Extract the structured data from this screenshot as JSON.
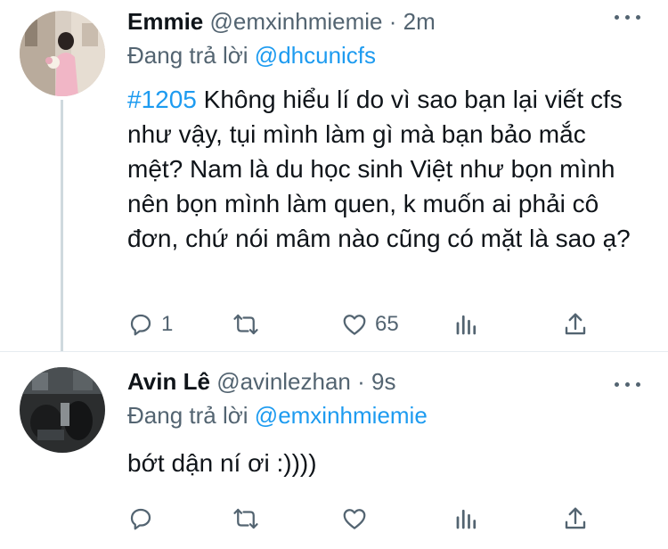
{
  "tweets": [
    {
      "name": "Emmie",
      "handle": "@emxinhmiemie",
      "separator": "·",
      "time": "2m",
      "replying_prefix": "Đang trả lời",
      "replying_to": "@dhcunicfs",
      "hashtag": "#1205",
      "text": " Không hiểu lí do vì sao bạn lại viết cfs như vậy, tụi mình làm gì mà bạn bảo mắc mệt? Nam là du học sinh Việt như bọn mình nên bọn mình làm quen, k muốn ai phải cô đơn, chứ nói mâm nào cũng có mặt là sao ạ?",
      "reply_count": "1",
      "retweet_count": "",
      "like_count": "65"
    },
    {
      "name": "Avin Lê",
      "handle": "@avinlezhan",
      "separator": "·",
      "time": "9s",
      "replying_prefix": "Đang trả lời",
      "replying_to": "@emxinhmiemie",
      "hashtag": "",
      "text": "bớt dận ní ơi :))))",
      "reply_count": "",
      "retweet_count": "",
      "like_count": ""
    }
  ],
  "colors": {
    "link": "#1d9bf0",
    "secondary": "#536471",
    "primary": "#0f1419",
    "thread_line": "#cfd9de"
  },
  "icons": [
    "reply-icon",
    "retweet-icon",
    "like-icon",
    "analytics-icon",
    "share-icon",
    "more-icon"
  ]
}
